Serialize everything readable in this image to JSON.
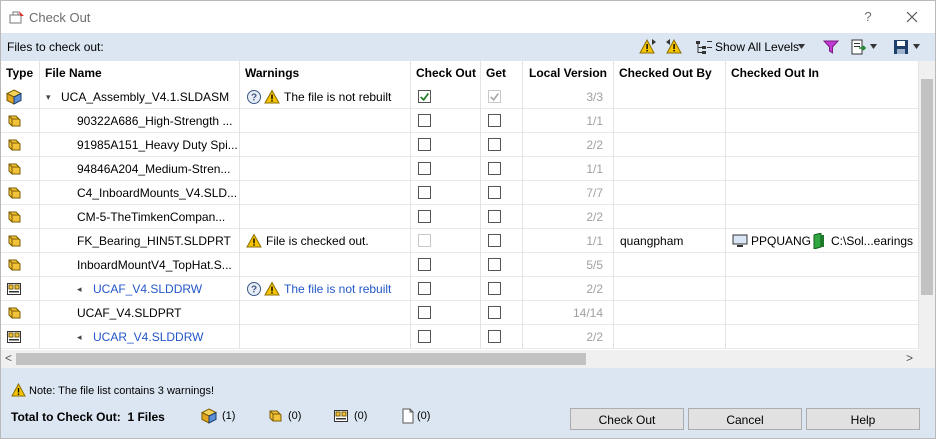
{
  "window": {
    "title": "Check Out",
    "help": "?"
  },
  "toolbar": {
    "label": "Files to check out:",
    "show_levels": "Show All Levels"
  },
  "columns": [
    "Type",
    "File Name",
    "Warnings",
    "Check Out",
    "Get",
    "Local Version",
    "Checked Out By",
    "Checked Out In"
  ],
  "rows": [
    {
      "type": "assembly",
      "indent": 0,
      "expander": "▾",
      "name": "UCA_Assembly_V4.1.SLDASM",
      "link": false,
      "warning": "The file is not rebuilt",
      "warn_icons": [
        "question",
        "warning"
      ],
      "checkout": "checked",
      "get": "checked-disabled",
      "version": "3/3",
      "by": "",
      "in_host": "",
      "in_path": ""
    },
    {
      "type": "part",
      "indent": 1,
      "expander": "",
      "name": "90322A686_High-Strength ...",
      "link": false,
      "warning": "",
      "warn_icons": [],
      "checkout": "empty",
      "get": "empty",
      "version": "1/1",
      "by": "",
      "in_host": "",
      "in_path": ""
    },
    {
      "type": "part",
      "indent": 1,
      "expander": "",
      "name": "91985A151_Heavy Duty Spi...",
      "link": false,
      "warning": "",
      "warn_icons": [],
      "checkout": "empty",
      "get": "empty",
      "version": "2/2",
      "by": "",
      "in_host": "",
      "in_path": ""
    },
    {
      "type": "part",
      "indent": 1,
      "expander": "",
      "name": "94846A204_Medium-Stren...",
      "link": false,
      "warning": "",
      "warn_icons": [],
      "checkout": "empty",
      "get": "empty",
      "version": "1/1",
      "by": "",
      "in_host": "",
      "in_path": ""
    },
    {
      "type": "part",
      "indent": 1,
      "expander": "",
      "name": "C4_InboardMounts_V4.SLD...",
      "link": false,
      "warning": "",
      "warn_icons": [],
      "checkout": "empty",
      "get": "empty",
      "version": "7/7",
      "by": "",
      "in_host": "",
      "in_path": ""
    },
    {
      "type": "part",
      "indent": 1,
      "expander": "",
      "name": "CM-5-TheTimkenCompan...",
      "link": false,
      "warning": "",
      "warn_icons": [],
      "checkout": "empty",
      "get": "empty",
      "version": "2/2",
      "by": "",
      "in_host": "",
      "in_path": ""
    },
    {
      "type": "part",
      "indent": 1,
      "expander": "",
      "name": "FK_Bearing_HIN5T.SLDPRT",
      "link": false,
      "warning": "File is checked out.",
      "warn_icons": [
        "warning"
      ],
      "checkout": "disabled",
      "get": "empty",
      "version": "1/1",
      "by": "quangpham",
      "in_host": "PPQUANG",
      "in_path": "C:\\Sol...earings"
    },
    {
      "type": "part",
      "indent": 1,
      "expander": "",
      "name": "InboardMountV4_TopHat.S...",
      "link": false,
      "warning": "",
      "warn_icons": [],
      "checkout": "empty",
      "get": "empty",
      "version": "5/5",
      "by": "",
      "in_host": "",
      "in_path": ""
    },
    {
      "type": "drawing",
      "indent": 1,
      "expander": "◂",
      "name": "UCAF_V4.SLDDRW",
      "link": true,
      "warning": "The file is not rebuilt",
      "warn_icons": [
        "question",
        "warning"
      ],
      "checkout": "empty",
      "get": "empty",
      "version": "2/2",
      "by": "",
      "in_host": "",
      "in_path": ""
    },
    {
      "type": "part",
      "indent": 1,
      "expander": "",
      "name": "UCAF_V4.SLDPRT",
      "link": false,
      "warning": "",
      "warn_icons": [],
      "checkout": "empty",
      "get": "empty",
      "version": "14/14",
      "by": "",
      "in_host": "",
      "in_path": ""
    },
    {
      "type": "drawing",
      "indent": 1,
      "expander": "◂",
      "name": "UCAR_V4.SLDDRW",
      "link": true,
      "warning": "",
      "warn_icons": [],
      "checkout": "empty",
      "get": "empty",
      "version": "2/2",
      "by": "",
      "in_host": "",
      "in_path": ""
    }
  ],
  "footer": {
    "note": "Note: The file list contains 3 warnings!",
    "total_label": "Total to Check Out:",
    "total_value": "1 Files",
    "counts": [
      "(1)",
      "(0)",
      "(0)",
      "(0)"
    ],
    "buttons": {
      "checkout": "Check Out",
      "cancel": "Cancel",
      "help": "Help"
    }
  },
  "colors": {
    "toolbar_bg": "#dce6f3",
    "link": "#2457c8",
    "warning": "#f5c400",
    "part": "#f2c33a"
  }
}
